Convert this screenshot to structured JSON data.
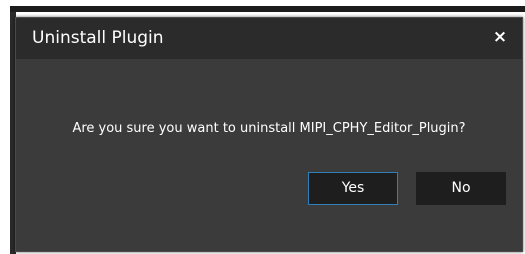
{
  "dialog": {
    "title": "Uninstall Plugin",
    "close_glyph": "×",
    "message": "Are you sure you want to uninstall MIPI_CPHY_Editor_Plugin?",
    "buttons": {
      "yes_label": "Yes",
      "no_label": "No"
    }
  },
  "colors": {
    "title_bar": "#2b2b2b",
    "dialog_body": "#3b3b3b",
    "button_bg": "#1e1e1e",
    "focus_border": "#2f7fb8",
    "text": "#ffffff"
  },
  "icons": {
    "close": "close-icon"
  }
}
